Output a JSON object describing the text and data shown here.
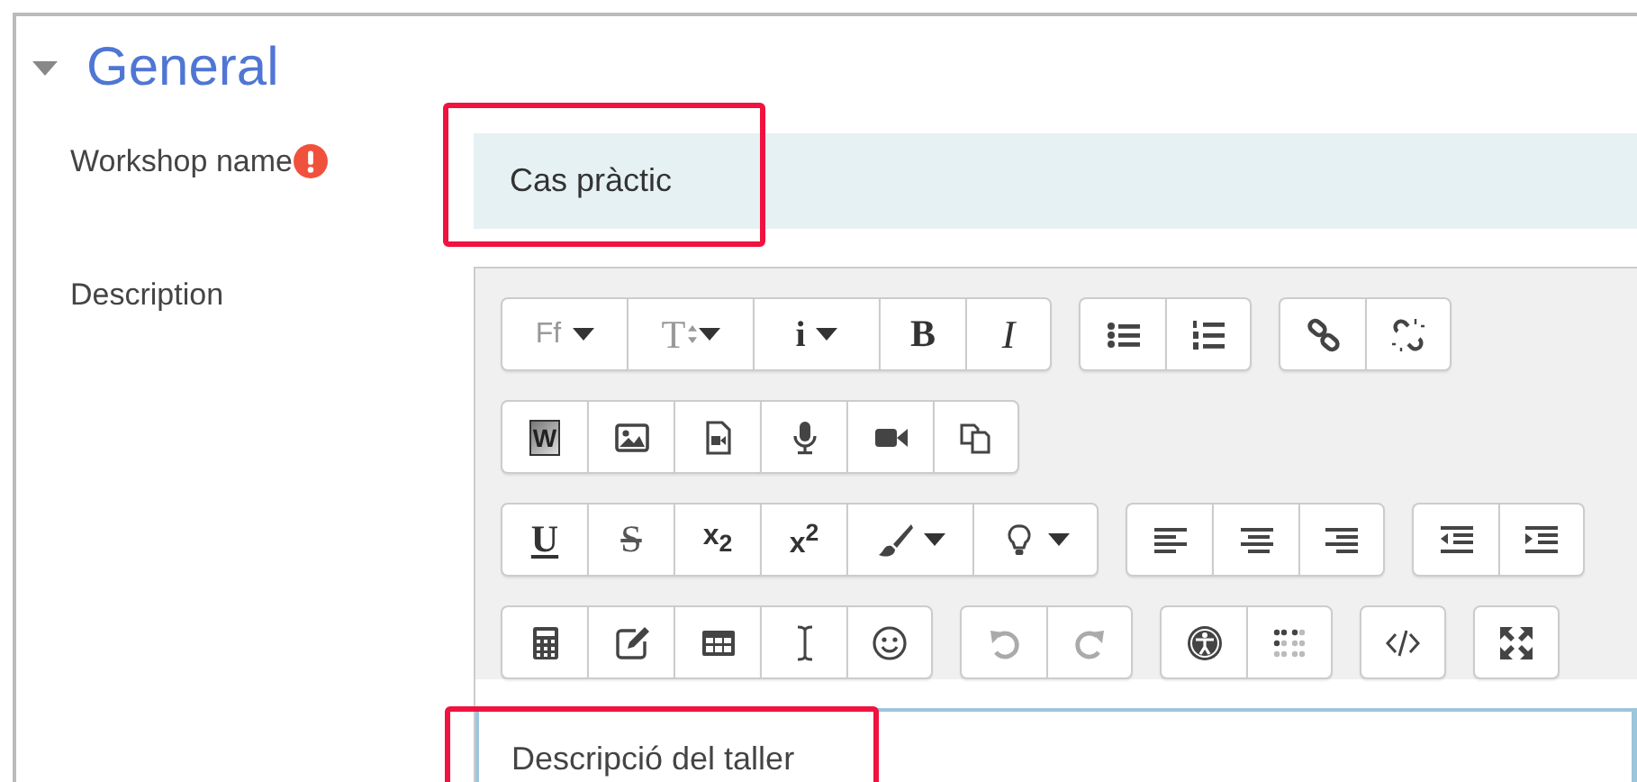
{
  "section": {
    "title": "General",
    "expanded": true
  },
  "fields": [
    {
      "label": "Workshop name",
      "required": true,
      "value": "Cas pràctic",
      "highlighted": true
    }
  ],
  "description": {
    "label": "Description",
    "highlighted": true,
    "value": "Descripció del taller",
    "toolbar": [
      [
        [
          {
            "kind": "font-family",
            "label": "Ff",
            "dropdown": true,
            "disabled": false
          },
          {
            "kind": "font-size",
            "label": "T",
            "dropdown": true,
            "disabled": false
          },
          {
            "kind": "styles",
            "label": "i",
            "dropdown": true,
            "disabled": false
          },
          {
            "kind": "bold",
            "label": "B",
            "dropdown": false,
            "disabled": false
          },
          {
            "kind": "italic",
            "label": "I",
            "dropdown": false,
            "disabled": false
          }
        ],
        [
          {
            "kind": "bullet-list",
            "dropdown": false,
            "disabled": false
          },
          {
            "kind": "numbered-list",
            "dropdown": false,
            "disabled": false
          }
        ],
        [
          {
            "kind": "link",
            "dropdown": false,
            "disabled": false
          },
          {
            "kind": "unlink",
            "dropdown": false,
            "disabled": false
          }
        ]
      ],
      [
        [
          {
            "kind": "word-paste",
            "label": "W",
            "dropdown": false,
            "disabled": false
          },
          {
            "kind": "image",
            "dropdown": false,
            "disabled": false
          },
          {
            "kind": "media",
            "dropdown": false,
            "disabled": false
          },
          {
            "kind": "audio",
            "dropdown": false,
            "disabled": false
          },
          {
            "kind": "video",
            "dropdown": false,
            "disabled": false
          },
          {
            "kind": "copy",
            "dropdown": false,
            "disabled": false
          }
        ]
      ],
      [
        [
          {
            "kind": "underline",
            "label": "U",
            "dropdown": false,
            "disabled": false
          },
          {
            "kind": "strike",
            "label": "S",
            "dropdown": false,
            "disabled": false
          },
          {
            "kind": "subscript",
            "label": "x$_{2}$",
            "dropdown": false,
            "disabled": false
          },
          {
            "kind": "superscript",
            "label": "x$^{2}$",
            "dropdown": false,
            "disabled": false
          },
          {
            "kind": "brush",
            "dropdown": true,
            "disabled": false
          },
          {
            "kind": "bulb",
            "dropdown": true,
            "disabled": false
          }
        ],
        [
          {
            "kind": "align-left",
            "dropdown": false,
            "disabled": false
          },
          {
            "kind": "align-center",
            "dropdown": false,
            "disabled": false
          },
          {
            "kind": "align-right",
            "dropdown": false,
            "disabled": false
          }
        ],
        [
          {
            "kind": "outdent",
            "dropdown": false,
            "disabled": false
          },
          {
            "kind": "indent",
            "dropdown": false,
            "disabled": false
          }
        ]
      ],
      [
        [
          {
            "kind": "calculator",
            "dropdown": false,
            "disabled": false
          },
          {
            "kind": "edit",
            "dropdown": false,
            "disabled": false
          },
          {
            "kind": "table",
            "dropdown": false,
            "disabled": false
          },
          {
            "kind": "cursor",
            "dropdown": false,
            "disabled": false
          },
          {
            "kind": "smiley",
            "dropdown": false,
            "disabled": false
          }
        ],
        [
          {
            "kind": "undo",
            "dropdown": false,
            "disabled": true
          },
          {
            "kind": "redo",
            "dropdown": false,
            "disabled": true
          }
        ],
        [
          {
            "kind": "accessibility",
            "dropdown": false,
            "disabled": false
          },
          {
            "kind": "braille",
            "dropdown": false,
            "disabled": false
          }
        ],
        [
          {
            "kind": "code",
            "dropdown": false,
            "disabled": false
          }
        ],
        [
          {
            "kind": "fullscreen",
            "dropdown": false,
            "disabled": false
          }
        ]
      ]
    ]
  }
}
